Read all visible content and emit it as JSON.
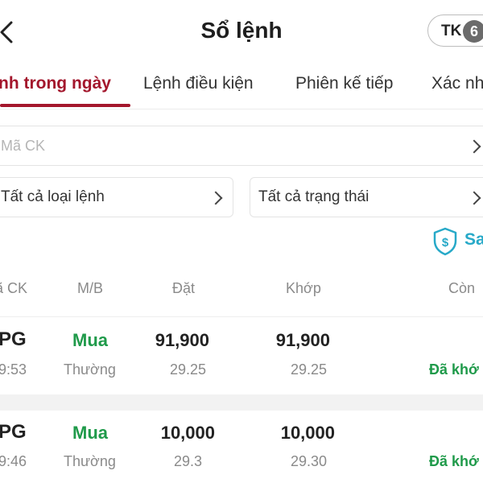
{
  "header": {
    "title": "Sổ lệnh",
    "account_label": "TK",
    "account_number": "6"
  },
  "tabs": [
    {
      "label": "nh trong ngày",
      "active": true
    },
    {
      "label": "Lệnh điều kiện",
      "active": false
    },
    {
      "label": "Phiên kế tiếp",
      "active": false
    },
    {
      "label": "Xác nh",
      "active": false
    }
  ],
  "search": {
    "placeholder": "Mã CK"
  },
  "filters": {
    "order_type": "Tất cả loại lệnh",
    "status": "Tất cả trạng thái"
  },
  "save_action": {
    "label": "Sa",
    "icon": "shield-dollar-icon"
  },
  "table": {
    "columns": [
      "ã CK",
      "M/B",
      "Đặt",
      "Khớp",
      "Còn"
    ],
    "rows": [
      {
        "symbol": "PG",
        "time": "9:53",
        "side": "Mua",
        "order_kind": "Thường",
        "order_volume": "91,900",
        "order_price": "29.25",
        "match_volume": "91,900",
        "match_price": "29.25",
        "status": "Đã khớ"
      },
      {
        "symbol": "PG",
        "time": "9:46",
        "side": "Mua",
        "order_kind": "Thường",
        "order_volume": "10,000",
        "order_price": "29.3",
        "match_volume": "10,000",
        "match_price": "29.30",
        "status": "Đã khớ"
      }
    ]
  },
  "colors": {
    "accent": "#a3162c",
    "buy": "#1f9a4a",
    "link": "#27a9c8"
  }
}
